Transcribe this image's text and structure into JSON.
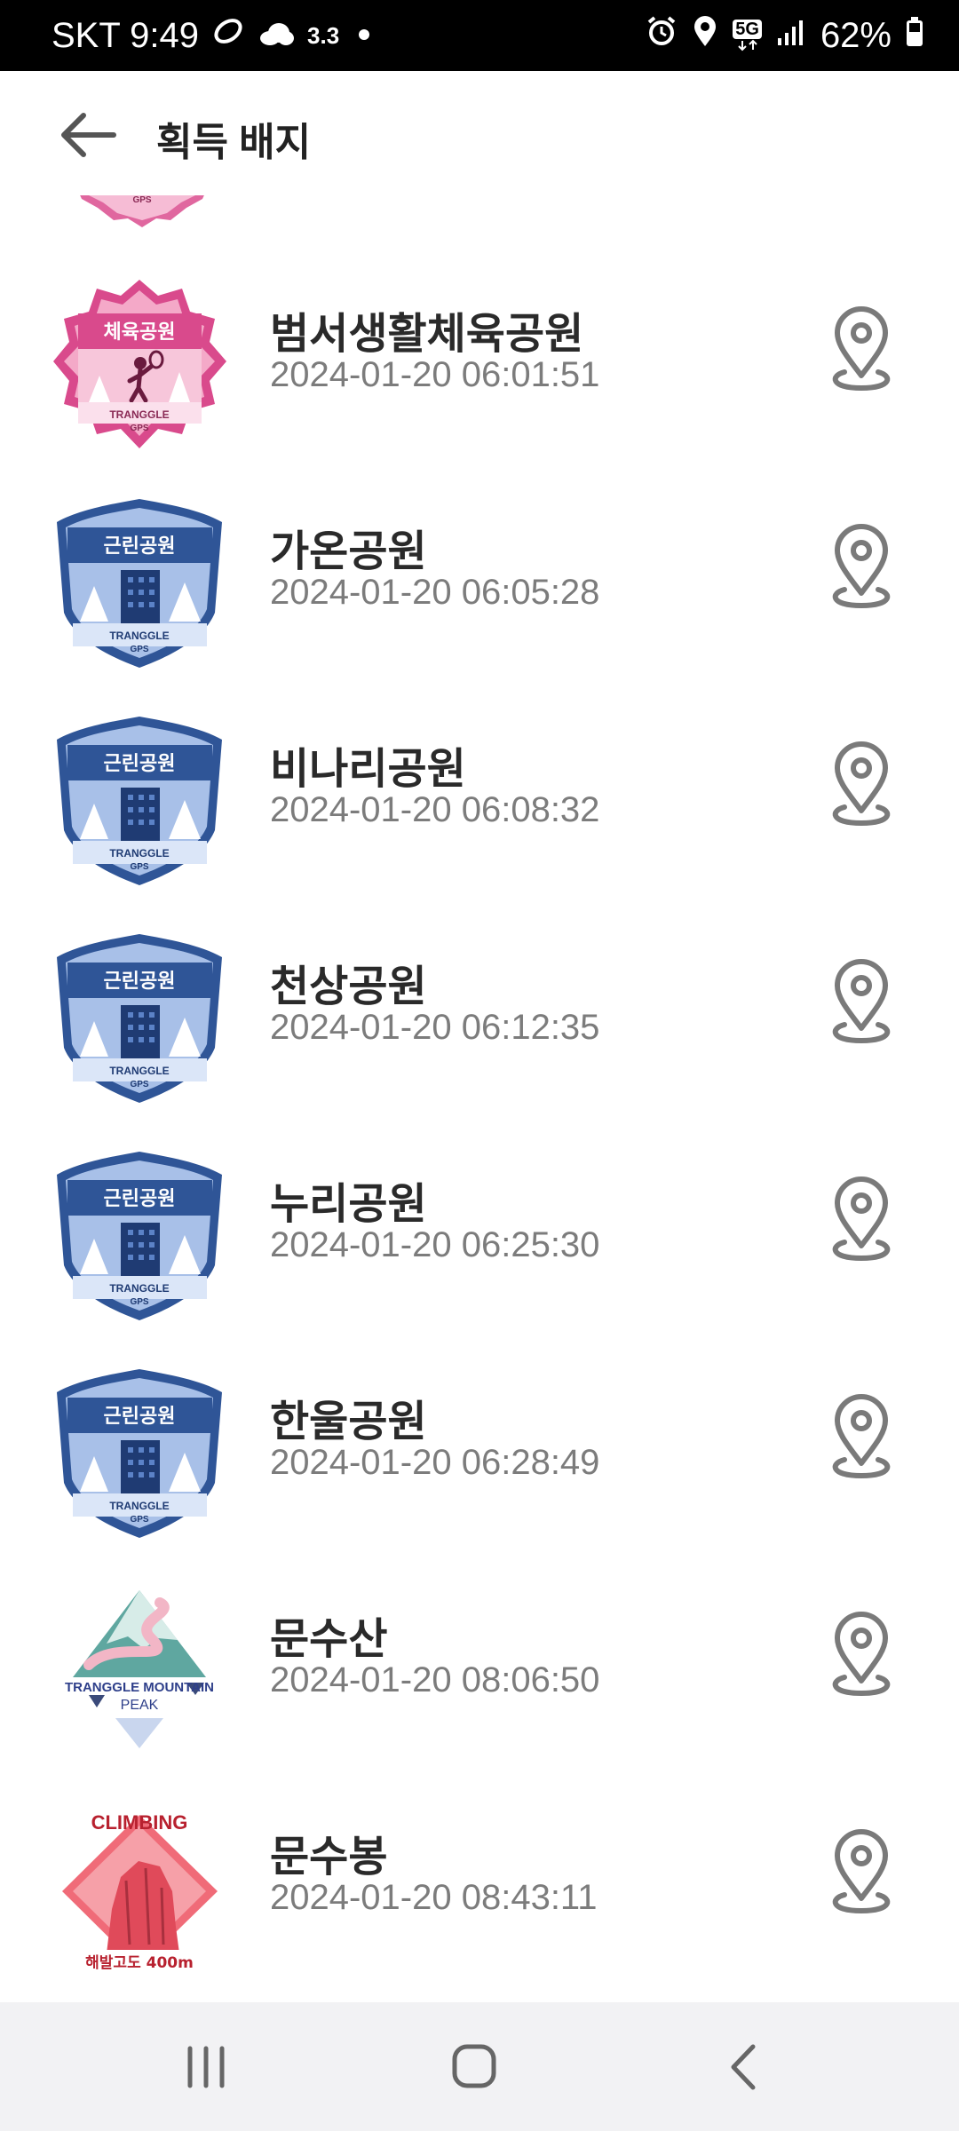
{
  "status_bar": {
    "carrier_time": "SKT 9:49",
    "temperature": "3.3",
    "network": "5G",
    "battery": "62%",
    "icons": [
      "shoe-icon",
      "cloud-icon",
      "dot-icon",
      "alarm-icon",
      "location-icon",
      "5g-icon",
      "signal-icon",
      "battery-icon"
    ]
  },
  "header": {
    "title": "획득 배지"
  },
  "badge_text": {
    "sports": "체육공원",
    "neighborhood": "근린공원",
    "tranggle": "TRANGGLE",
    "gps": "GPS",
    "mountain_line1": "TRANGGLE MOUNTAIN",
    "mountain_line2": "PEAK",
    "climbing": "CLIMBING",
    "altitude": "해발고도 400m"
  },
  "badges": [
    {
      "name": "범서생활체육공원",
      "datetime": "2024-01-20 06:01:51",
      "type": "sports"
    },
    {
      "name": "가온공원",
      "datetime": "2024-01-20 06:05:28",
      "type": "neighborhood"
    },
    {
      "name": "비나리공원",
      "datetime": "2024-01-20 06:08:32",
      "type": "neighborhood"
    },
    {
      "name": "천상공원",
      "datetime": "2024-01-20 06:12:35",
      "type": "neighborhood"
    },
    {
      "name": "누리공원",
      "datetime": "2024-01-20 06:25:30",
      "type": "neighborhood"
    },
    {
      "name": "한울공원",
      "datetime": "2024-01-20 06:28:49",
      "type": "neighborhood"
    },
    {
      "name": "문수산",
      "datetime": "2024-01-20 08:06:50",
      "type": "mountain"
    },
    {
      "name": "문수봉",
      "datetime": "2024-01-20 08:43:11",
      "type": "climbing"
    }
  ],
  "nav_bar": {
    "buttons": [
      "recent-apps-icon",
      "home-icon",
      "back-icon"
    ]
  },
  "colors": {
    "sports_badge": "#e0679f",
    "park_badge": "#2f5597",
    "text_primary": "#2a2a2a",
    "text_secondary": "#7c7c7c"
  }
}
